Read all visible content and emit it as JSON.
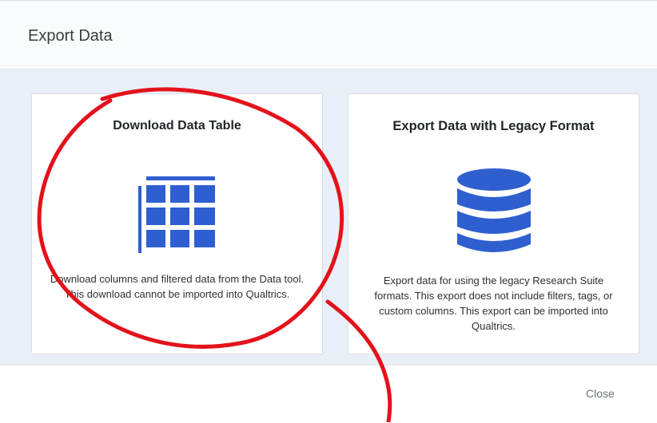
{
  "dialog": {
    "title": "Export Data",
    "close_label": "Close"
  },
  "options": [
    {
      "title": "Download Data Table",
      "icon": "table-grid-icon",
      "description": "Download columns and filtered data from the Data tool. This download cannot be imported into Qualtrics."
    },
    {
      "title": "Export Data with Legacy Format",
      "icon": "database-icon",
      "description": "Export data for using the legacy Research Suite formats. This export does not include filters, tags, or custom columns. This export can be imported into Qualtrics."
    }
  ],
  "colors": {
    "accent_blue": "#2f5fcf",
    "annotation_red": "#e3121b",
    "body_background": "#e9eff6"
  }
}
